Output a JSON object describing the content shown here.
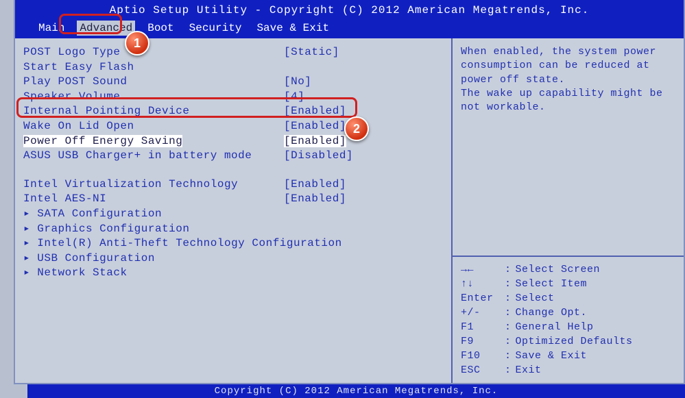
{
  "header": {
    "title": "Aptio Setup Utility - Copyright (C) 2012 American Megatrends, Inc."
  },
  "tabs": {
    "main": "Main",
    "advanced": "Advanced",
    "boot": "Boot",
    "security": "Security",
    "save_exit": "Save & Exit"
  },
  "settings": {
    "post_logo_type": {
      "label": "POST Logo Type",
      "value": "[Static]"
    },
    "start_easy_flash": {
      "label": "Start Easy Flash",
      "value": ""
    },
    "play_post_sound": {
      "label": "Play POST Sound",
      "value": "[No]"
    },
    "speaker_volume": {
      "label": "Speaker Volume",
      "value": "[4]"
    },
    "internal_pointing": {
      "label": "Internal Pointing Device",
      "value": "[Enabled]"
    },
    "wake_on_lid": {
      "label": "Wake On Lid Open",
      "value": "[Enabled]"
    },
    "power_off_energy": {
      "label": "Power Off Energy Saving",
      "value": "[Enabled]"
    },
    "asus_usb_charger": {
      "label": "ASUS USB Charger+ in battery mode",
      "value": "[Disabled]"
    },
    "intel_virt": {
      "label": "Intel Virtualization Technology",
      "value": "[Enabled]"
    },
    "intel_aes": {
      "label": "Intel AES-NI",
      "value": "[Enabled]"
    }
  },
  "submenus": {
    "sata": "SATA Configuration",
    "graphics": "Graphics Configuration",
    "anti_theft": "Intel(R) Anti-Theft Technology Configuration",
    "usb": "USB Configuration",
    "network": "Network Stack"
  },
  "help": {
    "text": "When enabled, the system power consumption can be reduced at power off state.\nThe wake up capability might be not workable."
  },
  "hints": {
    "select_screen": {
      "key": "→←",
      "sep": ":",
      "label": "Select Screen"
    },
    "select_item": {
      "key": "↑↓",
      "sep": ":",
      "label": "Select Item"
    },
    "enter": {
      "key": "Enter",
      "sep": ":",
      "label": "Select"
    },
    "change_opt": {
      "key": "+/-",
      "sep": ":",
      "label": "Change Opt."
    },
    "general_help": {
      "key": "F1",
      "sep": ":",
      "label": "General Help"
    },
    "opt_defaults": {
      "key": "F9",
      "sep": ":",
      "label": "Optimized Defaults"
    },
    "save_exit": {
      "key": "F10",
      "sep": ":",
      "label": "Save & Exit"
    },
    "esc": {
      "key": "ESC",
      "sep": ":",
      "label": "Exit"
    }
  },
  "footer": {
    "text": "Copyright (C) 2012 American Megatrends, Inc."
  },
  "annotations": {
    "badge1": "1",
    "badge2": "2"
  }
}
